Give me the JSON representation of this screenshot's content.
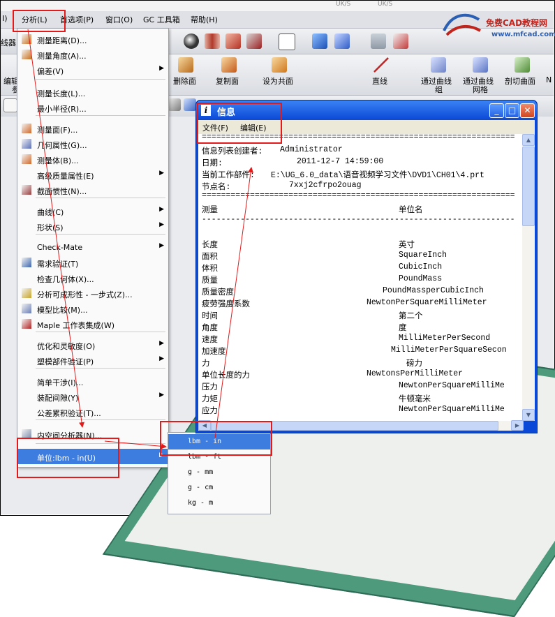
{
  "menubar": {
    "partial_left": "I)",
    "analysis": "分析(L)",
    "preferences": "首选项(P)",
    "window": "窗口(O)",
    "gc_toolbox": "GC 工具箱",
    "help": "帮助(H)"
  },
  "toolbar_left_fragments": {
    "a": "线器",
    "b": "编辑",
    "c": "参"
  },
  "toolbar2": {
    "delete_face": "删除面",
    "copy_face": "复制面",
    "set_coplanar": "设为共面",
    "line": "直线",
    "through_curve_group": "通过曲线",
    "through_curve_group2": "组",
    "through_curve_mesh": "通过曲线",
    "through_curve_mesh2": "网格",
    "section_surface": "剖切曲面",
    "more": "N"
  },
  "analysis_menu": {
    "items": [
      {
        "label": "测量距离(D)...",
        "icon": "ruler-icon",
        "arrow": false
      },
      {
        "label": "测量角度(A)...",
        "icon": "angle-icon",
        "arrow": false
      },
      {
        "label": "偏差(V)",
        "icon": "",
        "arrow": true
      },
      {
        "label": "测量长度(L)...",
        "icon": "",
        "arrow": false
      },
      {
        "label": "最小半径(R)...",
        "icon": "",
        "arrow": false
      },
      {
        "label": "测量面(F)...",
        "icon": "measure-face-icon",
        "arrow": false
      },
      {
        "label": "几何属性(G)...",
        "icon": "geometry-icon",
        "arrow": false
      },
      {
        "label": "测量体(B)...",
        "icon": "measure-body-icon",
        "arrow": false
      },
      {
        "label": "高级质量属性(E)",
        "icon": "",
        "arrow": true
      },
      {
        "label": "截面惯性(N)...",
        "icon": "section-icon",
        "arrow": false
      },
      {
        "label": "曲线(C)",
        "icon": "",
        "arrow": true
      },
      {
        "label": "形状(S)",
        "icon": "",
        "arrow": true
      },
      {
        "label": "Check-Mate",
        "icon": "",
        "arrow": true
      },
      {
        "label": "需求验证(T)",
        "icon": "checklist-icon",
        "arrow": false
      },
      {
        "label": "检查几何体(X)...",
        "icon": "",
        "arrow": false
      },
      {
        "label": "分析可成形性 - 一步式(Z)...",
        "icon": "formability-icon",
        "arrow": false
      },
      {
        "label": "模型比较(M)...",
        "icon": "compare-icon",
        "arrow": false
      },
      {
        "label": "Maple 工作表集成(W)",
        "icon": "maple-icon",
        "arrow": false
      },
      {
        "label": "优化和灵敏度(O)",
        "icon": "",
        "arrow": true
      },
      {
        "label": "塑模部件验证(P)",
        "icon": "",
        "arrow": true
      },
      {
        "label": "简单干涉(I)...",
        "icon": "",
        "arrow": false
      },
      {
        "label": "装配间隙(Y)",
        "icon": "",
        "arrow": true
      },
      {
        "label": "公差累积验证(T)...",
        "icon": "",
        "arrow": false
      },
      {
        "label": "内空间分析器(N)...",
        "icon": "space-icon",
        "arrow": false
      },
      {
        "label": "单位:lbm - in(U)",
        "icon": "",
        "arrow": true
      }
    ]
  },
  "units_submenu": {
    "items": [
      "lbm - in",
      "lbm - ft",
      "g - mm",
      "g - cm",
      "kg - m"
    ]
  },
  "info_window": {
    "title": "信息",
    "menu_file": "文件(F)",
    "menu_edit": "编辑(E)",
    "rule_double": "=================================================================",
    "rule_single": "-----------------------------------------------------------------",
    "creator_label": "信息列表创建者:",
    "creator_value": "Administrator",
    "date_label": "日期:",
    "date_value": "2011-12-7 14:59:00",
    "part_label": "当前工作部件:",
    "part_value": "E:\\UG_6.0_data\\语音视频学习文件\\DVD1\\CH01\\4.prt",
    "node_label": "节点名:",
    "node_value": "7xxj2cfrpo2ouag",
    "col_measure": "测量",
    "col_unit": "单位名",
    "rows": [
      {
        "measure": "长度",
        "unit": "英寸"
      },
      {
        "measure": "面积",
        "unit": "SquareInch"
      },
      {
        "measure": "体积",
        "unit": "CubicInch"
      },
      {
        "measure": "质量",
        "unit": "PoundMass"
      },
      {
        "measure": "质量密度",
        "unit": "PoundMassperCubicInch"
      },
      {
        "measure": "疲劳强度系数",
        "unit": "NewtonPerSquareMilliMeter"
      },
      {
        "measure": "时间",
        "unit": "第二个"
      },
      {
        "measure": "角度",
        "unit": "度"
      },
      {
        "measure": "速度",
        "unit": "MilliMeterPerSecond"
      },
      {
        "measure": "加速度",
        "unit": "MilliMeterPerSquareSecon"
      },
      {
        "measure": "力",
        "unit": "磅力"
      },
      {
        "measure": "单位长度的力",
        "unit": "NewtonsPerMilliMeter"
      },
      {
        "measure": "压力",
        "unit": "NewtonPerSquareMilliMe"
      },
      {
        "measure": "力矩",
        "unit": "牛顿毫米"
      },
      {
        "measure": "应力",
        "unit": "NewtonPerSquareMilliMe"
      }
    ]
  },
  "watermark": {
    "text1": "免费CAD教程网",
    "text2": "www.mfcad.com"
  },
  "speed_left": "UK/S",
  "speed_right": "UK/S",
  "colors": {
    "annotation_red": "#e31a1a",
    "title_blue": "#0a49d6",
    "highlight": "#3d7de0",
    "model_green": "#4d9a7c"
  }
}
